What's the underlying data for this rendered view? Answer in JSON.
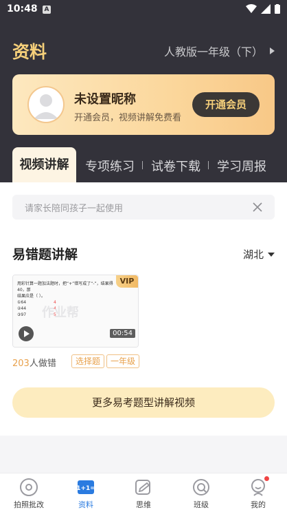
{
  "status": {
    "time": "10:48",
    "notif": "A"
  },
  "header": {
    "title": "资料",
    "grade": "人教版一年级（下）"
  },
  "vip_card": {
    "nickname": "未设置昵称",
    "desc": "开通会员，视频讲解免费看",
    "button": "开通会员"
  },
  "tabs": [
    "视频讲解",
    "专项练习",
    "试卷下载",
    "学习周报"
  ],
  "tip": {
    "text": "请家长陪同孩子一起使用"
  },
  "section": {
    "title": "易错题讲解",
    "region": "湖北"
  },
  "video": {
    "badge": "VIP",
    "duration": "00:54",
    "watermark": "作业帮",
    "wrong_num": "203",
    "wrong_suffix": "人做错",
    "tags": [
      "选择题",
      "一年级"
    ],
    "question_lines": [
      "用彩针算一题加法题时，把“+”错写成了“-”，结果得40，那",
      "结果应是（    ）。",
      "①64",
      "②44",
      "③97"
    ]
  },
  "more_button": "更多易考题型讲解视频",
  "nav": [
    {
      "label": "拍照批改",
      "icon": "camera-icon"
    },
    {
      "label": "资料",
      "icon": "materials-icon"
    },
    {
      "label": "思维",
      "icon": "thinking-icon"
    },
    {
      "label": "班级",
      "icon": "class-icon"
    },
    {
      "label": "我的",
      "icon": "profile-icon"
    }
  ],
  "colors": {
    "gold": "#f6d07a",
    "dark": "#33323a",
    "accent_blue": "#2a7be0",
    "orange": "#e8a14c"
  }
}
